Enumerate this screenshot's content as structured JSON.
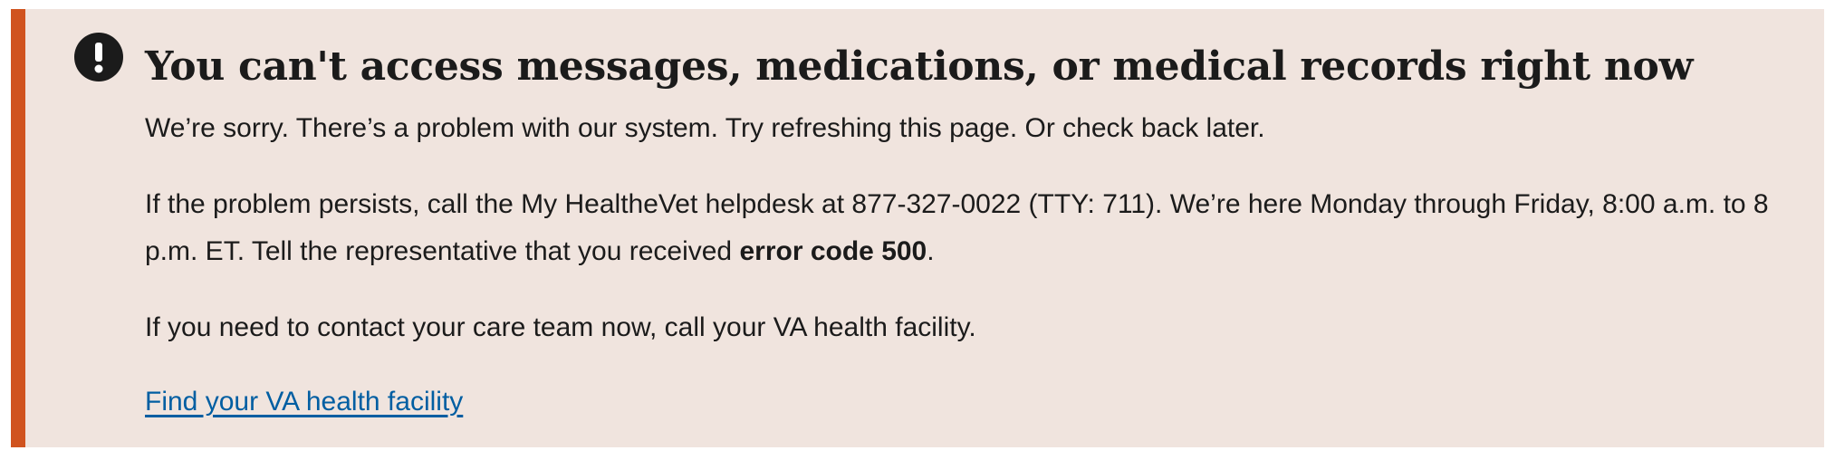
{
  "alert": {
    "type": "error",
    "icon": "exclamation-circle-icon",
    "accent_color": "#d0531f",
    "background_color": "#f0e4de",
    "heading": "You can't access messages, medications, or medical records right now",
    "paragraph_1": "We’re sorry. There’s a problem with our system. Try refreshing this page. Or check back later.",
    "paragraph_2_before": "If the problem persists, call the My HealtheVet helpdesk at 877-327-0022 (TTY: 711). We’re here Monday through Friday, 8:00 a.m. to 8 p.m. ET. Tell the representative that you received ",
    "paragraph_2_bold": "error code 500",
    "paragraph_2_after": ".",
    "paragraph_3": "If you need to contact your care team now, call your VA health facility.",
    "link_text": "Find your VA health facility",
    "link_color": "#005ea2"
  }
}
